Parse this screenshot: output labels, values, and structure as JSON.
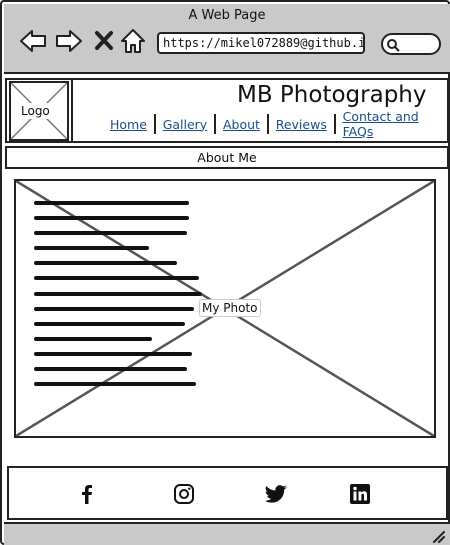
{
  "browser": {
    "title": "A Web Page",
    "url": "https://mikel072889@github.io/m"
  },
  "header": {
    "logo_label": "Logo",
    "brand": "MB Photography",
    "nav": [
      "Home",
      "Gallery",
      "About",
      "Reviews",
      "Contact and FAQs"
    ]
  },
  "about": {
    "heading": "About Me"
  },
  "photo": {
    "label": "My Photo"
  },
  "footer": {
    "icons": [
      "facebook-icon",
      "instagram-icon",
      "twitter-icon",
      "linkedin-icon"
    ]
  }
}
